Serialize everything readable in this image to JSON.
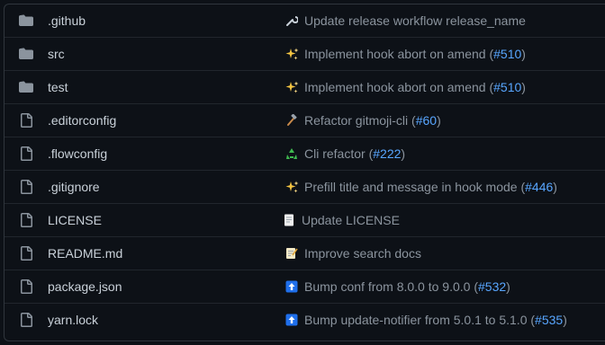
{
  "files": [
    {
      "name": ".github",
      "type": "folder",
      "emoji": "wrench",
      "message": "Update release workflow release_name",
      "pr": ""
    },
    {
      "name": "src",
      "type": "folder",
      "emoji": "sparkles",
      "message": "Implement hook abort on amend",
      "pr": "#510"
    },
    {
      "name": "test",
      "type": "folder",
      "emoji": "sparkles",
      "message": "Implement hook abort on amend",
      "pr": "#510"
    },
    {
      "name": ".editorconfig",
      "type": "file",
      "emoji": "hammer",
      "message": "Refactor gitmoji-cli",
      "pr": "#60"
    },
    {
      "name": ".flowconfig",
      "type": "file",
      "emoji": "recycle",
      "message": "Cli refactor",
      "pr": "#222"
    },
    {
      "name": ".gitignore",
      "type": "file",
      "emoji": "sparkles",
      "message": "Prefill title and message in hook mode",
      "pr": "#446"
    },
    {
      "name": "LICENSE",
      "type": "file",
      "emoji": "page",
      "message": "Update LICENSE",
      "pr": ""
    },
    {
      "name": "README.md",
      "type": "file",
      "emoji": "memo",
      "message": "Improve search docs",
      "pr": ""
    },
    {
      "name": "package.json",
      "type": "file",
      "emoji": "arrow-up",
      "message": "Bump conf from 8.0.0 to 9.0.0",
      "pr": "#532"
    },
    {
      "name": "yarn.lock",
      "type": "file",
      "emoji": "arrow-up",
      "message": "Bump update-notifier from 5.0.1 to 5.1.0",
      "pr": "#535"
    }
  ],
  "colors": {
    "background": "#0d1117",
    "folder_icon": "#8b949e",
    "file_icon": "#8b949e",
    "text": "#c9d1d9",
    "muted": "#8b949e",
    "link": "#58a6ff",
    "border": "#21262d"
  }
}
